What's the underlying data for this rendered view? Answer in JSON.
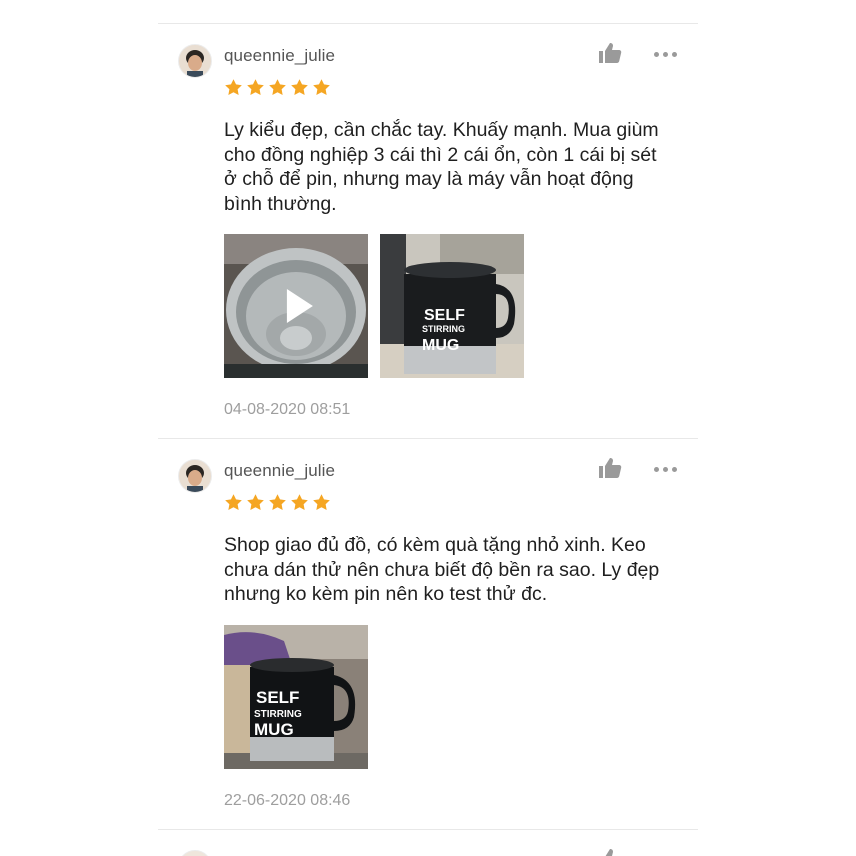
{
  "colors": {
    "star": "#f5a623",
    "text": "#1f1f1f",
    "muted": "#9e9e9e",
    "icon": "#9a9a9a",
    "divider": "#e8e8e8"
  },
  "reviews": [
    {
      "username": "queennie_julie",
      "rating": 5,
      "text": "Ly kiểu đẹp,  cần chắc tay.  Khuấy mạnh. Mua giùm cho đồng nghiệp 3 cái thì 2 cái ổn,  còn 1 cái bị sét ở chỗ để pin,  nhưng may là máy vẫn hoạt động bình thường.",
      "media": [
        {
          "type": "video",
          "icon": "play-icon"
        },
        {
          "type": "photo",
          "label_lines": [
            "SELF",
            "STIRRING",
            "MUG"
          ]
        }
      ],
      "date": "04-08-2020 08:51"
    },
    {
      "username": "queennie_julie",
      "rating": 5,
      "text": "Shop giao đủ đồ,  có kèm quà tặng nhỏ xinh.  Keo chưa dán thử nên chưa biết độ bền ra sao. Ly đẹp nhưng ko kèm pin nên ko test thử đc.",
      "media": [
        {
          "type": "photo",
          "label_lines": [
            "SELF",
            "STIRRING",
            "MUG"
          ]
        }
      ],
      "date": "22-06-2020 08:46"
    }
  ],
  "icons": {
    "like": "thumbs-up-icon",
    "more": "more-options-icon",
    "star": "star-icon"
  }
}
